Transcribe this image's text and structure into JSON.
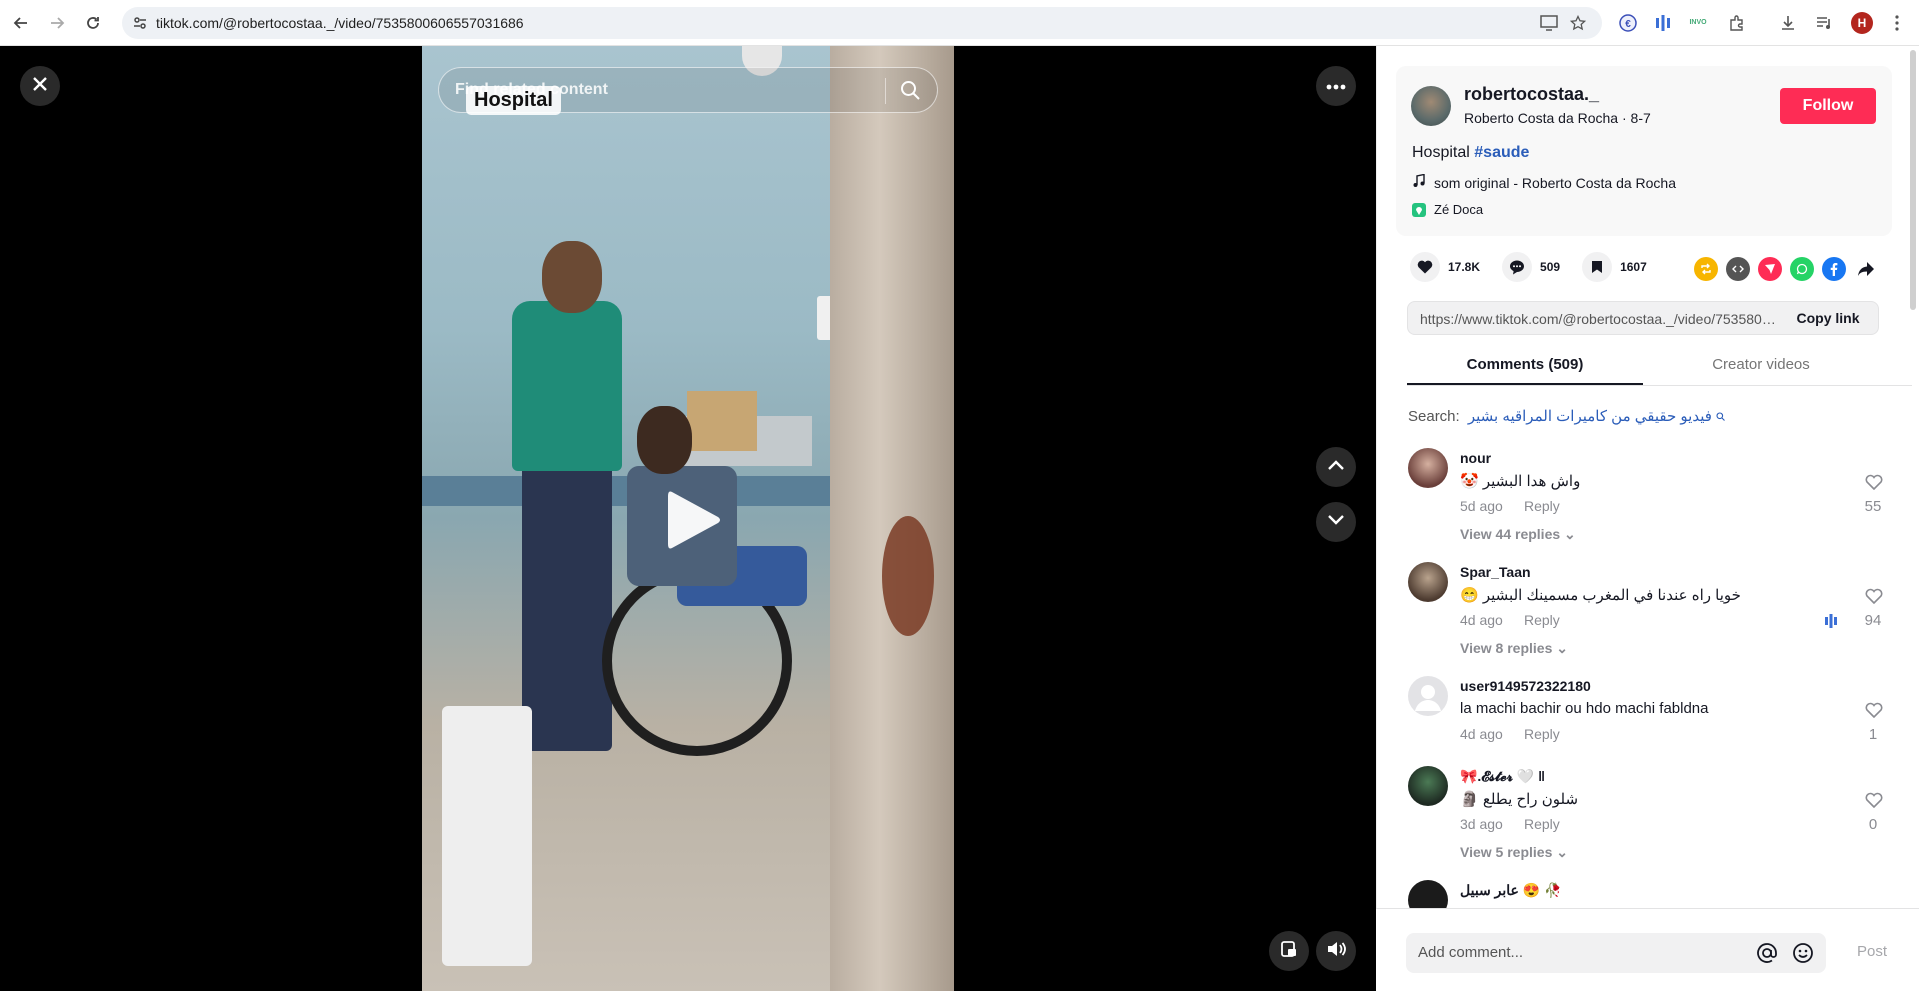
{
  "browser": {
    "url": "tiktok.com/@robertocostaa._/video/7535800606557031686",
    "profile_initial": "H",
    "ext_text": "INVO"
  },
  "video": {
    "overlay_label": "Hospital",
    "search_placeholder": "Find related content"
  },
  "author": {
    "handle": "robertocostaa._",
    "meta": "Roberto Costa da Rocha · 8-7",
    "follow_label": "Follow",
    "caption_text": "Hospital",
    "caption_tag": "#saude",
    "music": "som original - Roberto Costa da Rocha",
    "location": "Zé Doca"
  },
  "stats": {
    "likes": "17.8K",
    "comments": "509",
    "saves": "1607"
  },
  "link": {
    "url": "https://www.tiktok.com/@robertocostaa._/video/7535800606557031686",
    "copy_label": "Copy link"
  },
  "tabs": {
    "comments": "Comments (509)",
    "creator": "Creator videos"
  },
  "search": {
    "label": "Search:",
    "query": "فيديو حقيقي من كاميرات المراقيه بشير"
  },
  "comments": [
    {
      "user": "nour",
      "text": "🤡 واش هدا البشير",
      "time": "5d ago",
      "reply": "Reply",
      "likes": "55",
      "replies": "View 44 replies"
    },
    {
      "user": "Spar_Taan",
      "text": "😁 خويا راه عندنا في المغرب مسمينك البشير",
      "time": "4d ago",
      "reply": "Reply",
      "likes": "94",
      "replies": "View 8 replies"
    },
    {
      "user": "user9149572322180",
      "text": "la machi bachir ou hdo machi fabldna",
      "time": "4d ago",
      "reply": "Reply",
      "likes": "1",
      "replies": ""
    },
    {
      "user": "🎀.𝓔𝓼𝓽𝓮𝓻 🤍 ‖",
      "text": "🗿 شلون راح يطلع",
      "time": "3d ago",
      "reply": "Reply",
      "likes": "0",
      "replies": "View 5 replies"
    },
    {
      "user": "عابر سبيل 😍 🥀",
      "text": "",
      "time": "",
      "reply": "",
      "likes": "",
      "replies": ""
    }
  ],
  "composer": {
    "placeholder": "Add comment...",
    "post_label": "Post"
  }
}
